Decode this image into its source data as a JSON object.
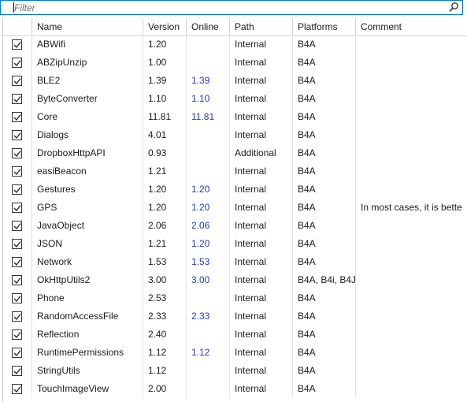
{
  "filter": {
    "placeholder": "Filter",
    "value": ""
  },
  "columns": {
    "checked": "",
    "name": "Name",
    "version": "Version",
    "online": "Online",
    "path": "Path",
    "platforms": "Platforms",
    "comment": "Comment"
  },
  "rows": [
    {
      "checked": true,
      "name": "ABWifi",
      "version": "1.20",
      "online": "",
      "path": "Internal",
      "platforms": "B4A",
      "comment": ""
    },
    {
      "checked": true,
      "name": "ABZipUnzip",
      "version": "1.00",
      "online": "",
      "path": "Internal",
      "platforms": "B4A",
      "comment": ""
    },
    {
      "checked": true,
      "name": "BLE2",
      "version": "1.39",
      "online": "1.39",
      "path": "Internal",
      "platforms": "B4A",
      "comment": ""
    },
    {
      "checked": true,
      "name": "ByteConverter",
      "version": "1.10",
      "online": "1.10",
      "path": "Internal",
      "platforms": "B4A",
      "comment": ""
    },
    {
      "checked": true,
      "name": "Core",
      "version": "11.81",
      "online": "11.81",
      "path": "Internal",
      "platforms": "B4A",
      "comment": ""
    },
    {
      "checked": true,
      "name": "Dialogs",
      "version": "4.01",
      "online": "",
      "path": "Internal",
      "platforms": "B4A",
      "comment": ""
    },
    {
      "checked": true,
      "name": "DropboxHttpAPI",
      "version": "0.93",
      "online": "",
      "path": "Additional",
      "platforms": "B4A",
      "comment": ""
    },
    {
      "checked": true,
      "name": "easiBeacon",
      "version": "1.21",
      "online": "",
      "path": "Internal",
      "platforms": "B4A",
      "comment": ""
    },
    {
      "checked": true,
      "name": "Gestures",
      "version": "1.20",
      "online": "1.20",
      "path": "Internal",
      "platforms": "B4A",
      "comment": ""
    },
    {
      "checked": true,
      "name": "GPS",
      "version": "1.20",
      "online": "1.20",
      "path": "Internal",
      "platforms": "B4A",
      "comment": "In most cases, it is bette"
    },
    {
      "checked": true,
      "name": "JavaObject",
      "version": "2.06",
      "online": "2.06",
      "path": "Internal",
      "platforms": "B4A",
      "comment": ""
    },
    {
      "checked": true,
      "name": "JSON",
      "version": "1.21",
      "online": "1.20",
      "path": "Internal",
      "platforms": "B4A",
      "comment": ""
    },
    {
      "checked": true,
      "name": "Network",
      "version": "1.53",
      "online": "1.53",
      "path": "Internal",
      "platforms": "B4A",
      "comment": ""
    },
    {
      "checked": true,
      "name": "OkHttpUtils2",
      "version": "3.00",
      "online": "3.00",
      "path": "Internal",
      "platforms": "B4A, B4i, B4J",
      "comment": ""
    },
    {
      "checked": true,
      "name": "Phone",
      "version": "2.53",
      "online": "",
      "path": "Internal",
      "platforms": "B4A",
      "comment": ""
    },
    {
      "checked": true,
      "name": "RandomAccessFile",
      "version": "2.33",
      "online": "2.33",
      "path": "Internal",
      "platforms": "B4A",
      "comment": ""
    },
    {
      "checked": true,
      "name": "Reflection",
      "version": "2.40",
      "online": "",
      "path": "Internal",
      "platforms": "B4A",
      "comment": ""
    },
    {
      "checked": true,
      "name": "RuntimePermissions",
      "version": "1.12",
      "online": "1.12",
      "path": "Internal",
      "platforms": "B4A",
      "comment": ""
    },
    {
      "checked": true,
      "name": "StringUtils",
      "version": "1.12",
      "online": "",
      "path": "Internal",
      "platforms": "B4A",
      "comment": ""
    },
    {
      "checked": true,
      "name": "TouchImageView",
      "version": "2.00",
      "online": "",
      "path": "Internal",
      "platforms": "B4A",
      "comment": ""
    }
  ],
  "icons": {
    "search": "search-icon",
    "check": "check-icon"
  },
  "colors": {
    "online_text": "#1f3bd1",
    "focus_border": "#0078d7"
  }
}
